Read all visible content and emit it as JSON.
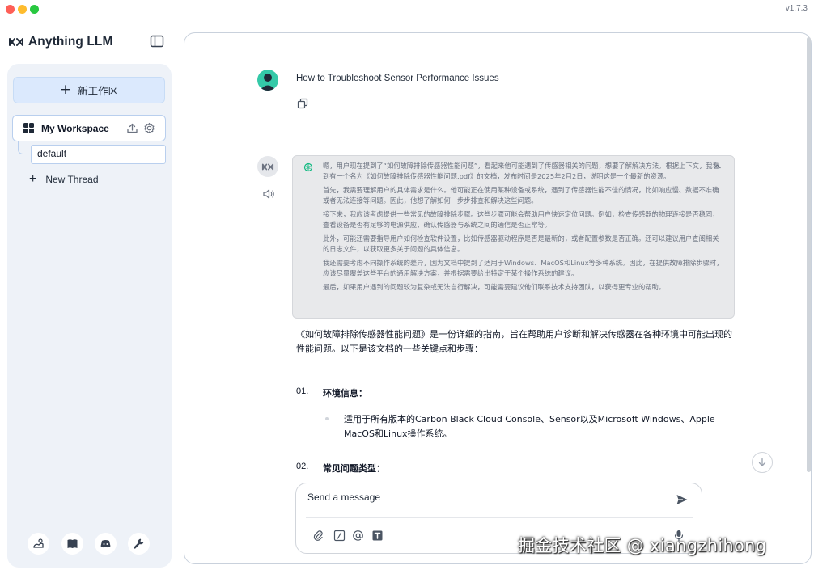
{
  "app": {
    "version": "v1.7.3"
  },
  "brand": {
    "name": "Anything LLM"
  },
  "sidebar": {
    "new_workspace_label": "新工作区",
    "workspace": {
      "name": "My Workspace"
    },
    "thread": {
      "name": "default"
    },
    "new_thread_label": "New Thread"
  },
  "chat": {
    "user_message": "How to Troubleshoot Sensor Performance Issues",
    "thought": [
      "嗯，用户现在提到了“如何故障排除传感器性能问题”，看起来他可能遇到了传感器相关的问题，想要了解解决方法。根据上下文，我看到有一个名为《如何故障排除传感器性能问题.pdf》的文档，发布时间是2025年2月2日，说明这是一个最新的资源。",
      "首先，我需要理解用户的具体需求是什么。他可能正在使用某种设备或系统，遇到了传感器性能不佳的情况，比如响应慢、数据不准确或者无法连接等问题。因此，他想了解如何一步步排查和解决这些问题。",
      "接下来，我应该考虑提供一些常见的故障排除步骤。这些步骤可能会帮助用户快速定位问题。例如，检查传感器的物理连接是否稳固，查看设备是否有足够的电源供应，确认传感器与系统之间的通信是否正常等。",
      "此外，可能还需要指导用户如何检查软件设置，比如传感器驱动程序是否是最新的，或者配置参数是否正确。还可以建议用户查阅相关的日志文件，以获取更多关于问题的具体信息。",
      "我还需要考虑不同操作系统的差异，因为文档中提到了适用于Windows、MacOS和Linux等多种系统。因此，在提供故障排除步骤时，应该尽量覆盖这些平台的通用解决方案，并根据需要给出特定于某个操作系统的建议。",
      "最后，如果用户遇到的问题较为复杂或无法自行解决，可能需要建议他们联系技术支持团队，以获得更专业的帮助。"
    ],
    "answer_intro": "《如何故障排除传感器性能问题》是一份详细的指南，旨在帮助用户诊断和解决传感器在各种环境中可能出现的性能问题。以下是该文档的一些关键点和步骤：",
    "sections": [
      {
        "num": "01.",
        "title": "环境信息：",
        "bullet": "适用于所有版本的Carbon Black Cloud Console、Sensor以及Microsoft Windows、Apple MacOS和Linux操作系统。"
      },
      {
        "num": "02.",
        "title": "常见问题类型："
      }
    ]
  },
  "composer": {
    "placeholder": "Send a message"
  },
  "watermark": "掘金技术社区 @ xiangzhihong",
  "colors": {
    "accent": "#dbe9fd",
    "sidebar_bg": "#eef2f8",
    "user_avatar": "#34c9a8",
    "thought_bg": "#e8e9eb"
  }
}
